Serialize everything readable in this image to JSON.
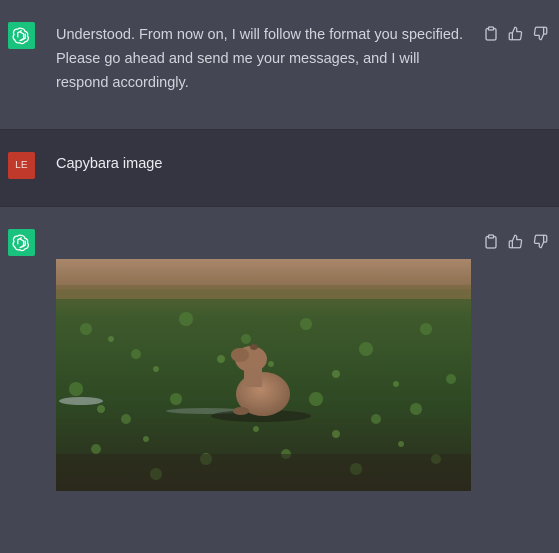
{
  "messages": [
    {
      "role": "assistant",
      "text": "Understood. From now on, I will follow the format you specified. Please go ahead and send me your messages, and I will respond accordingly.",
      "avatar_icon": "openai-logo-icon",
      "actions": [
        "clipboard-icon",
        "thumbs-up-icon",
        "thumbs-down-icon"
      ]
    },
    {
      "role": "user",
      "avatar_initials": "LE",
      "text": "Capybara image"
    },
    {
      "role": "assistant",
      "avatar_icon": "openai-logo-icon",
      "image": {
        "subject": "capybara-photo"
      },
      "actions": [
        "clipboard-icon",
        "thumbs-up-icon",
        "thumbs-down-icon"
      ]
    }
  ],
  "colors": {
    "assistant_bg": "#444654",
    "user_bg": "#343541",
    "bot_avatar": "#19c37d",
    "user_avatar": "#c0392b"
  }
}
